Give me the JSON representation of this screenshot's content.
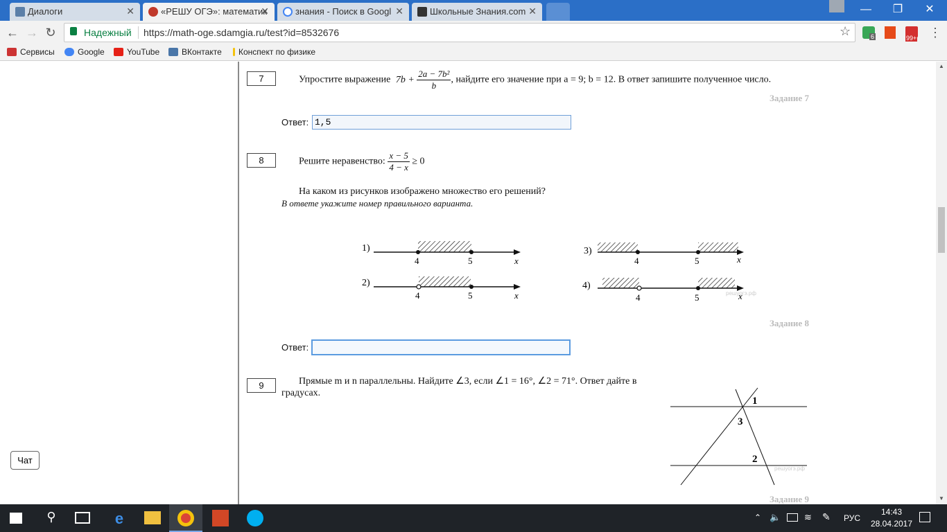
{
  "tabs": [
    {
      "label": "Диалоги",
      "icon": "vk-chat-icon",
      "color": "#5b7fa8"
    },
    {
      "label": "«РЕШУ ОГЭ»: математик",
      "icon": "reshu-oge-icon",
      "color": "#c0392b"
    },
    {
      "label": "знания - Поиск в Googl",
      "icon": "google-g-icon",
      "color": "#4285f4"
    },
    {
      "label": "Школьные Знания.com",
      "icon": "znanija-icon",
      "color": "#333333"
    }
  ],
  "toolbar": {
    "secure_label": "Надежный",
    "url": "https://math-oge.sdamgia.ru/test?id=8532676",
    "ext_badge_1": "6",
    "ext_badge_2": "99+"
  },
  "bookmarks": [
    {
      "label": "Сервисы",
      "icon": "apps-grid-icon"
    },
    {
      "label": "Google",
      "icon": "google-g-icon"
    },
    {
      "label": "YouTube",
      "icon": "youtube-icon"
    },
    {
      "label": "ВКонтакте",
      "icon": "vk-icon"
    },
    {
      "label": "Конспект по физике",
      "icon": "bookmark-page-icon"
    }
  ],
  "sidebar": {
    "chat_label": "Чат"
  },
  "q7": {
    "number": "7",
    "text_before": "Упростите выражение",
    "expr_prefix": "7b +",
    "frac_num": "2a − 7b²",
    "frac_den": "b",
    "text_after": ", найдите его значение при  a = 9;  b = 12. В ответ запишите полученное число.",
    "tag": "Задание 7",
    "answer_label": "Ответ:",
    "answer_value": "1,5"
  },
  "q8": {
    "number": "8",
    "text_before": "Решите неравенство:",
    "frac_num": "x − 5",
    "frac_den": "4 − x",
    "text_after": "≥ 0",
    "question": "На каком из рисунков изображено множество его решений?",
    "hint": "В ответе укажите номер правильного варианта.",
    "options": [
      {
        "label": "1)",
        "left": "4",
        "right": "5",
        "axis": "x"
      },
      {
        "label": "2)",
        "left": "4",
        "right": "5",
        "axis": "x"
      },
      {
        "label": "3)",
        "left": "4",
        "right": "5",
        "axis": "x"
      },
      {
        "label": "4)",
        "left": "4",
        "right": "5",
        "axis": "x"
      }
    ],
    "watermark": "решуогэ.рф",
    "tag": "Задание 8",
    "answer_label": "Ответ:",
    "answer_value": ""
  },
  "q9": {
    "number": "9",
    "text_line1": "Прямые m и n параллельны. Найдите ∠3, если ∠1 = 16°, ∠2 = 71°. Ответ дайте в",
    "text_line2": "градусах.",
    "angle_labels": [
      "1",
      "3",
      "2"
    ],
    "watermark": "решуогэ.рф",
    "tag": "Задание 9"
  },
  "taskbar": {
    "lang": "РУС",
    "time": "14:43",
    "date": "28.04.2017"
  }
}
